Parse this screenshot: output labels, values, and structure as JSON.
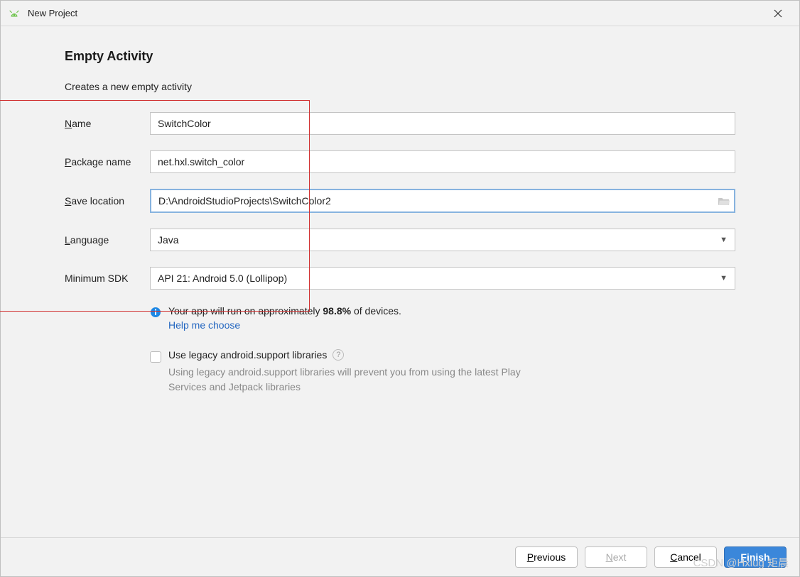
{
  "window": {
    "title": "New Project",
    "close_icon": "close-icon"
  },
  "section": {
    "title": "Empty Activity",
    "description": "Creates a new empty activity"
  },
  "fields": {
    "name": {
      "label_pre": "N",
      "label_rest": "ame",
      "value": "SwitchColor"
    },
    "package": {
      "label_pre": "P",
      "label_rest": "ackage name",
      "value": "net.hxl.switch_color"
    },
    "save_location": {
      "label_pre": "S",
      "label_rest": "ave location",
      "value": "D:\\AndroidStudioProjects\\SwitchColor2"
    },
    "language": {
      "label_pre": "L",
      "label_rest": "anguage",
      "value": "Java"
    },
    "min_sdk": {
      "label": "Minimum SDK",
      "value": "API 21: Android 5.0 (Lollipop)"
    }
  },
  "info": {
    "text_pre": "Your app will run on approximately ",
    "percent": "98.8%",
    "text_post": " of devices.",
    "help_link": "Help me choose"
  },
  "legacy": {
    "label": "Use legacy android.support libraries",
    "desc": "Using legacy android.support libraries will prevent you from using the latest Play Services and Jetpack libraries"
  },
  "footer": {
    "previous_pre": "P",
    "previous_rest": "revious",
    "next_pre": "N",
    "next_rest": "ext",
    "cancel_pre": "C",
    "cancel_rest": "ancel",
    "finish_pre": "F",
    "finish_rest": "inish"
  },
  "watermark": "CSDN @Hxlug 矩晨"
}
